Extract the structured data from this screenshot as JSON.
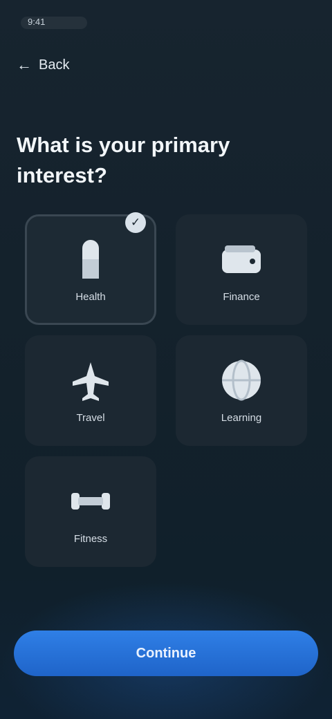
{
  "status": {
    "time": "9:41"
  },
  "header": {
    "back_label": "Back",
    "back_icon": "arrow-left-icon"
  },
  "title": "What is your primary interest?",
  "options": [
    {
      "label": "Health",
      "icon": "pill-icon",
      "selected": true
    },
    {
      "label": "Finance",
      "icon": "wallet-icon",
      "selected": false
    },
    {
      "label": "Travel",
      "icon": "plane-icon",
      "selected": false
    },
    {
      "label": "Learning",
      "icon": "globe-icon",
      "selected": false
    },
    {
      "label": "Fitness",
      "icon": "dumbbell-icon",
      "selected": false
    }
  ],
  "footer": {
    "continue_label": "Continue"
  },
  "colors": {
    "accent": "#2a73d9",
    "background": "#142230",
    "tile": "#1c2832"
  }
}
